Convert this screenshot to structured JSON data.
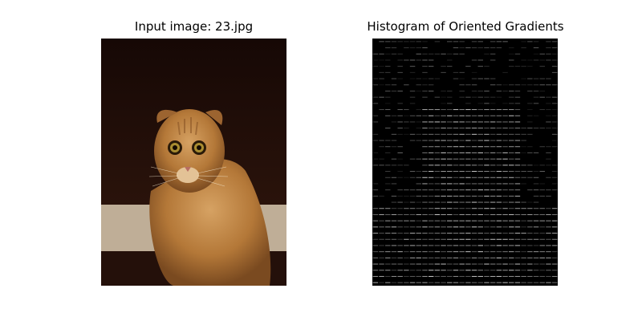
{
  "figure": {
    "left_title": "Input image: 23.jpg",
    "right_title": "Histogram of Oriented Gradients"
  },
  "left_image": {
    "subject": "scottish fold cat",
    "colors": {
      "background": "#1f0c07",
      "wall": "#bfae97",
      "floor": "#24100a",
      "fur": "#b47838",
      "fur_light": "#d6a263",
      "eye_ring": "#2a1a08",
      "eye_iris": "#a98d31"
    }
  },
  "right_image": {
    "colors": {
      "background": "#000000",
      "stroke_bright": "#ffffff",
      "stroke_dim": "#6e6e6e"
    }
  }
}
